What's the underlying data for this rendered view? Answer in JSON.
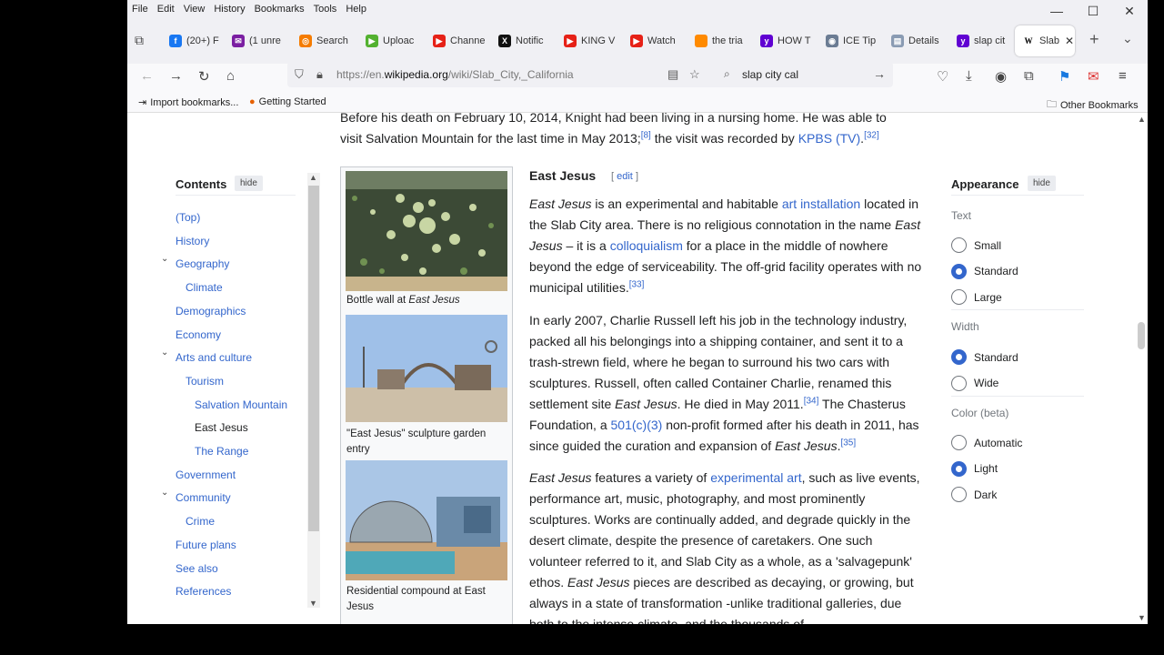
{
  "menu": [
    "File",
    "Edit",
    "View",
    "History",
    "Bookmarks",
    "Tools",
    "Help"
  ],
  "tabs": [
    {
      "label": "(20+) F",
      "color": "#1877f2",
      "glyph": "f"
    },
    {
      "label": "(1 unre",
      "color": "#7b1fa2",
      "glyph": "✉"
    },
    {
      "label": "Search",
      "color": "#f57c00",
      "glyph": "◎"
    },
    {
      "label": "Uploac",
      "color": "#53b130",
      "glyph": "▶"
    },
    {
      "label": "Channe",
      "color": "#e62117",
      "glyph": "▶"
    },
    {
      "label": "Notific",
      "color": "#111111",
      "glyph": "X"
    },
    {
      "label": "KING V",
      "color": "#e62117",
      "glyph": "▶"
    },
    {
      "label": "Watch",
      "color": "#e62117",
      "glyph": "▶"
    },
    {
      "label": "the tria",
      "color": "#ff8a00",
      "glyph": ""
    },
    {
      "label": "HOW T",
      "color": "#6001d2",
      "glyph": "y"
    },
    {
      "label": "ICE Tip",
      "color": "#6b7c93",
      "glyph": "◉"
    },
    {
      "label": "Details",
      "color": "#8a9bb3",
      "glyph": "▤"
    },
    {
      "label": "slap cit",
      "color": "#6001d2",
      "glyph": "y"
    },
    {
      "label": "Slab",
      "color": "#ffffff",
      "glyph": "W"
    }
  ],
  "url": {
    "prefix": "https://en.",
    "domain": "wikipedia.org",
    "path": "/wiki/Slab_City,_California"
  },
  "search": {
    "value": "slap city cal"
  },
  "bookmarks": {
    "import": "Import bookmarks...",
    "getting_started": "Getting Started",
    "other": "Other Bookmarks"
  },
  "intro": {
    "line1": "Before his death on February 10, 2014, Knight had been living in a nursing home. He was able to",
    "line2a": "visit Salvation Mountain for the last time in May 2013;",
    "ref1": "[8]",
    "line2b": " the visit was recorded by ",
    "kpbs": "KPBS (TV)",
    "line2c": ".",
    "ref2": "[32]"
  },
  "toc": {
    "title": "Contents",
    "hide": "hide",
    "items": [
      "(Top)",
      "History",
      "Geography",
      "Climate",
      "Demographics",
      "Economy",
      "Arts and culture",
      "Tourism",
      "Salvation Mountain",
      "East Jesus",
      "The Range",
      "Government",
      "Community",
      "Crime",
      "Future plans",
      "See also",
      "References"
    ]
  },
  "images": {
    "cap1a": "Bottle wall at ",
    "cap1b": "East Jesus",
    "cap2": "\"East Jesus\" sculpture garden entry",
    "cap3": "Residential compound at East Jesus"
  },
  "section": {
    "title": "East Jesus",
    "edit": "[ edit ]",
    "edit_open": "[",
    "edit_label": "edit",
    "edit_close": "]"
  },
  "p1": {
    "a": "East Jesus",
    "b": " is an experimental and habitable ",
    "link1": "art installation",
    "c": " located in the Slab City area. There is no religious connotation in the name ",
    "d": "East Jesus",
    "e": " – it is a ",
    "link2": "colloquialism",
    "f": " for a place in the middle of nowhere beyond the edge of serviceability. The off-grid facility operates with no municipal utilities.",
    "ref": "[33]"
  },
  "p2": {
    "a": "In early 2007, Charlie Russell left his job in the technology industry, packed all his belongings into a shipping container, and sent it to a trash-strewn field, where he began to surround his two cars with sculptures. Russell, often called Container Charlie, renamed this settlement site ",
    "b": "East Jesus",
    "c": ". He died in May 2011.",
    "ref1": "[34]",
    "d": " The Chasterus Foundation, a ",
    "link": "501(c)(3)",
    "e": " non-profit formed after his death in 2011, has since guided the curation and expansion of ",
    "f": "East Jesus",
    "g": ".",
    "ref2": "[35]"
  },
  "p3": {
    "a": "East Jesus",
    "b": " features a variety of ",
    "link": "experimental art",
    "c": ", such as live events, performance art, music, photography, and most prominently sculptures. Works are continually added, and degrade quickly in the desert climate, despite the presence of caretakers. One such volunteer referred to it, and Slab City as a whole, as a 'salvagepunk' ethos. ",
    "d": "East Jesus",
    "e": " pieces are described as decaying, or growing, but always in a state of transformation -unlike traditional galleries, due both to the intense climate, and the thousands of"
  },
  "appearance": {
    "title": "Appearance",
    "hide": "hide",
    "text_head": "Text",
    "text_opts": [
      "Small",
      "Standard",
      "Large"
    ],
    "width_head": "Width",
    "width_opts": [
      "Standard",
      "Wide"
    ],
    "color_head": "Color (beta)",
    "color_opts": [
      "Automatic",
      "Light",
      "Dark"
    ],
    "selected": {
      "text": "Standard",
      "width": "Standard",
      "color": "Light"
    }
  }
}
